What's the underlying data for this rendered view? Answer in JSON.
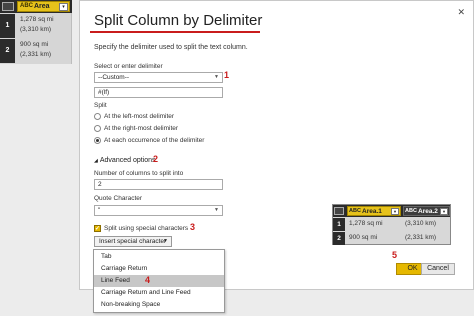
{
  "background_table": {
    "column": "Area",
    "column_icon": "ABC",
    "rows": [
      {
        "num": "1",
        "line1": "1,278 sq mi",
        "line2": "(3,310 km)"
      },
      {
        "num": "2",
        "line1": "900 sq mi",
        "line2": "(2,331 km)"
      }
    ]
  },
  "dialog": {
    "title": "Split Column by Delimiter",
    "close": "✕",
    "description": "Specify the delimiter used to split the text column.",
    "delimiter_label": "Select or enter delimiter",
    "delimiter_value": "--Custom--",
    "custom_value": "#(lf)",
    "split_label": "Split",
    "split_options": [
      "At the left-most delimiter",
      "At the right-most delimiter",
      "At each occurrence of the delimiter"
    ],
    "advanced_label": "Advanced options",
    "columns_label": "Number of columns to split into",
    "columns_value": "2",
    "quote_label": "Quote Character",
    "quote_value": "\"",
    "special_chars_label": "Split using special characters",
    "insert_button": "Insert special character",
    "menu_items": [
      "Tab",
      "Carriage Return",
      "Line Feed",
      "Carriage Return and Line Feed",
      "Non-breaking Space"
    ],
    "ok": "OK",
    "cancel": "Cancel"
  },
  "annotations": [
    "1",
    "2",
    "3",
    "4",
    "5"
  ],
  "result_table": {
    "columns": [
      "Area.1",
      "Area.2"
    ],
    "column_icon": "ABC",
    "rows": [
      {
        "num": "1",
        "a": "1,278 sq mi",
        "b": "(3,310 km)"
      },
      {
        "num": "2",
        "a": "900 sq mi",
        "b": "(2,331 km)"
      }
    ]
  },
  "colors": {
    "accent": "#e6c21b",
    "annotation": "#c91c1c",
    "header": "#2b2b2b"
  }
}
